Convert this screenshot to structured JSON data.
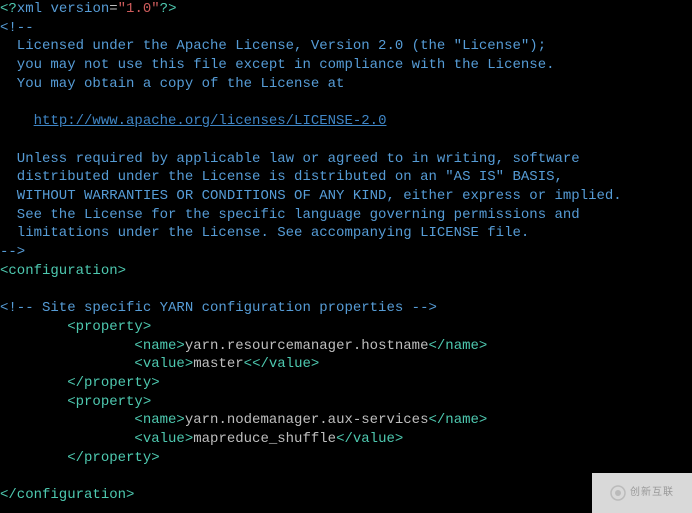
{
  "xml_decl": {
    "open": "<?",
    "name": "xml",
    "space": " ",
    "attr": "version",
    "eq": "=",
    "val": "\"1.0\"",
    "close": "?>"
  },
  "comment_open": "<!--",
  "license_l1": "  Licensed under the Apache License, Version 2.0 (the \"License\");",
  "license_l2": "  you may not use this file except in compliance with the License.",
  "license_l3": "  You may obtain a copy of the License at",
  "license_blank1": "",
  "license_url_indent": "    ",
  "license_url": "http://www.apache.org/licenses/LICENSE-2.0",
  "license_blank2": "",
  "license_l4": "  Unless required by applicable law or agreed to in writing, software",
  "license_l5": "  distributed under the License is distributed on an \"AS IS\" BASIS,",
  "license_l6": "  WITHOUT WARRANTIES OR CONDITIONS OF ANY KIND, either express or implied.",
  "license_l7": "  See the License for the specific language governing permissions and",
  "license_l8": "  limitations under the License. See accompanying LICENSE file.",
  "comment_close": "-->",
  "conf_open": "<configuration>",
  "blank_line": "",
  "site_comment": "<!-- Site specific YARN configuration properties -->",
  "indent8": "        ",
  "indent16": "                ",
  "prop_open": "<property>",
  "prop_close": "</property>",
  "name_open": "<name>",
  "name_close": "</name>",
  "value_open": "<value>",
  "value_open_short": "value>",
  "value_close": "</value>",
  "p1_name": "yarn.resourcemanager.hostname",
  "p1_value": "master",
  "p1_lt": "<",
  "p2_name": "yarn.nodemanager.aux-services",
  "p2_value": "mapreduce_shuffle",
  "conf_close": "</configuration>",
  "prompt": "~",
  "watermark": "创新互联"
}
